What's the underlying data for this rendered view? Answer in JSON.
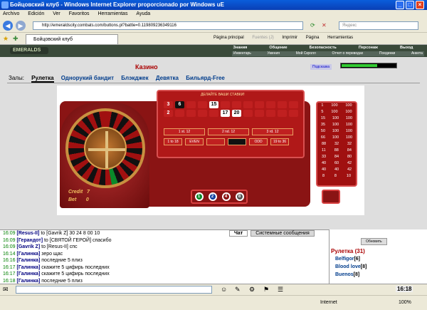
{
  "window": {
    "title": "Бойцовский клуб - Windows Internet Explorer proporcionado por Windows uE"
  },
  "menu": [
    "Archivo",
    "Edición",
    "Ver",
    "Favoritos",
    "Herramientas",
    "Ayuda"
  ],
  "address": {
    "url": "http://emeraldscity.combats.com/buttons.pl?battle=0.119809236349116",
    "search_placeholder": "Яндекс"
  },
  "tabs": [
    {
      "label": "Бойцовский клуб"
    }
  ],
  "commands": [
    "Página principal",
    "Fuentes (J)",
    "Imprimir",
    "Página",
    "Herramientas"
  ],
  "game_header": {
    "logo": "EMERALDS",
    "nav": [
      "Знания",
      "Общение",
      "Безопасность",
      "Персонаж",
      "Выход"
    ],
    "subnav": [
      "Инвентарь",
      "Умения",
      "Мой Скролл",
      "Отчет о переводах",
      "Поединки",
      "Анкета"
    ]
  },
  "casino": {
    "title": "Казино",
    "hint_button": "Подсказка",
    "halls_label": "Залы:",
    "halls": [
      "Рулетка",
      "Однорукий бандит",
      "Блэкджек",
      "Девятка",
      "Бильярд-Free"
    ],
    "active_hall": 0,
    "make_bet_text": "ДЕЛАЙТЕ ВАШИ СТАВКИ!",
    "credit_label": "Credit",
    "credit_value": "7",
    "bet_label": "Bet",
    "bet_value": "0",
    "table_row1": [
      "3",
      "6",
      "",
      "",
      "15",
      "",
      "",
      "",
      "",
      "",
      "",
      ""
    ],
    "table_row2": [
      "2",
      "",
      "",
      "",
      "",
      "17",
      "20",
      "",
      "",
      "",
      "",
      ""
    ],
    "dozens": [
      "1 st. 12",
      "2 nd. 12",
      "3 rd. 12"
    ],
    "even_money": [
      "1 to 18",
      "EVEN",
      "",
      "",
      "ODD",
      "19 to 36"
    ],
    "chips": [
      "1",
      "2",
      "4",
      "8"
    ],
    "payout_rows": [
      [
        "1",
        "100",
        "100"
      ],
      [
        "5",
        "100",
        "100"
      ],
      [
        "15",
        "100",
        "100"
      ],
      [
        "35",
        "100",
        "100"
      ],
      [
        "50",
        "100",
        "100"
      ],
      [
        "66",
        "100",
        "100"
      ],
      [
        "88",
        "32",
        "32"
      ],
      [
        "11",
        "88",
        "84"
      ],
      [
        "33",
        "84",
        "80"
      ],
      [
        "40",
        "60",
        "42"
      ],
      [
        "40",
        "40",
        "42"
      ],
      [
        "8",
        "8",
        "10"
      ]
    ]
  },
  "chat": {
    "tabs": [
      "Чат",
      "Системные сообщения"
    ],
    "lines": [
      {
        "time": "16:09",
        "name": "[Resus-II]",
        "text": "to [Gavrik Z] 30 24 8 00 10"
      },
      {
        "time": "16:09",
        "name": "[Герандот]",
        "text": "to [СВЯТОЙ ГЕРОЙ] спасибо"
      },
      {
        "time": "16:09",
        "name": "[Gavrik Z]",
        "text": "to [Resus-II] спс"
      },
      {
        "time": "16:14",
        "name": "[Галинка]",
        "text": "зеро щас"
      },
      {
        "time": "16:16",
        "name": "[Галинка]",
        "text": "последние 5 плиз"
      },
      {
        "time": "16:17",
        "name": "[Галинка]",
        "text": "скажите 5 цифирь последних"
      },
      {
        "time": "16:17",
        "name": "[Галинка]",
        "text": "скажите 5 цифирь последних"
      },
      {
        "time": "16:18",
        "name": "[Галинка]",
        "text": "последние 5 плиз"
      }
    ]
  },
  "room": {
    "refresh_button": "Обновить",
    "name": "Рулетка (31)",
    "players": [
      {
        "name": "Belfigor",
        "level": "[6]"
      },
      {
        "name": "Blood love",
        "level": "[8]"
      },
      {
        "name": "Buenos",
        "level": "[8]"
      }
    ]
  },
  "bottom": {
    "clock": "16:18"
  },
  "status": {
    "zone": "Internet",
    "zoom": "100%"
  }
}
